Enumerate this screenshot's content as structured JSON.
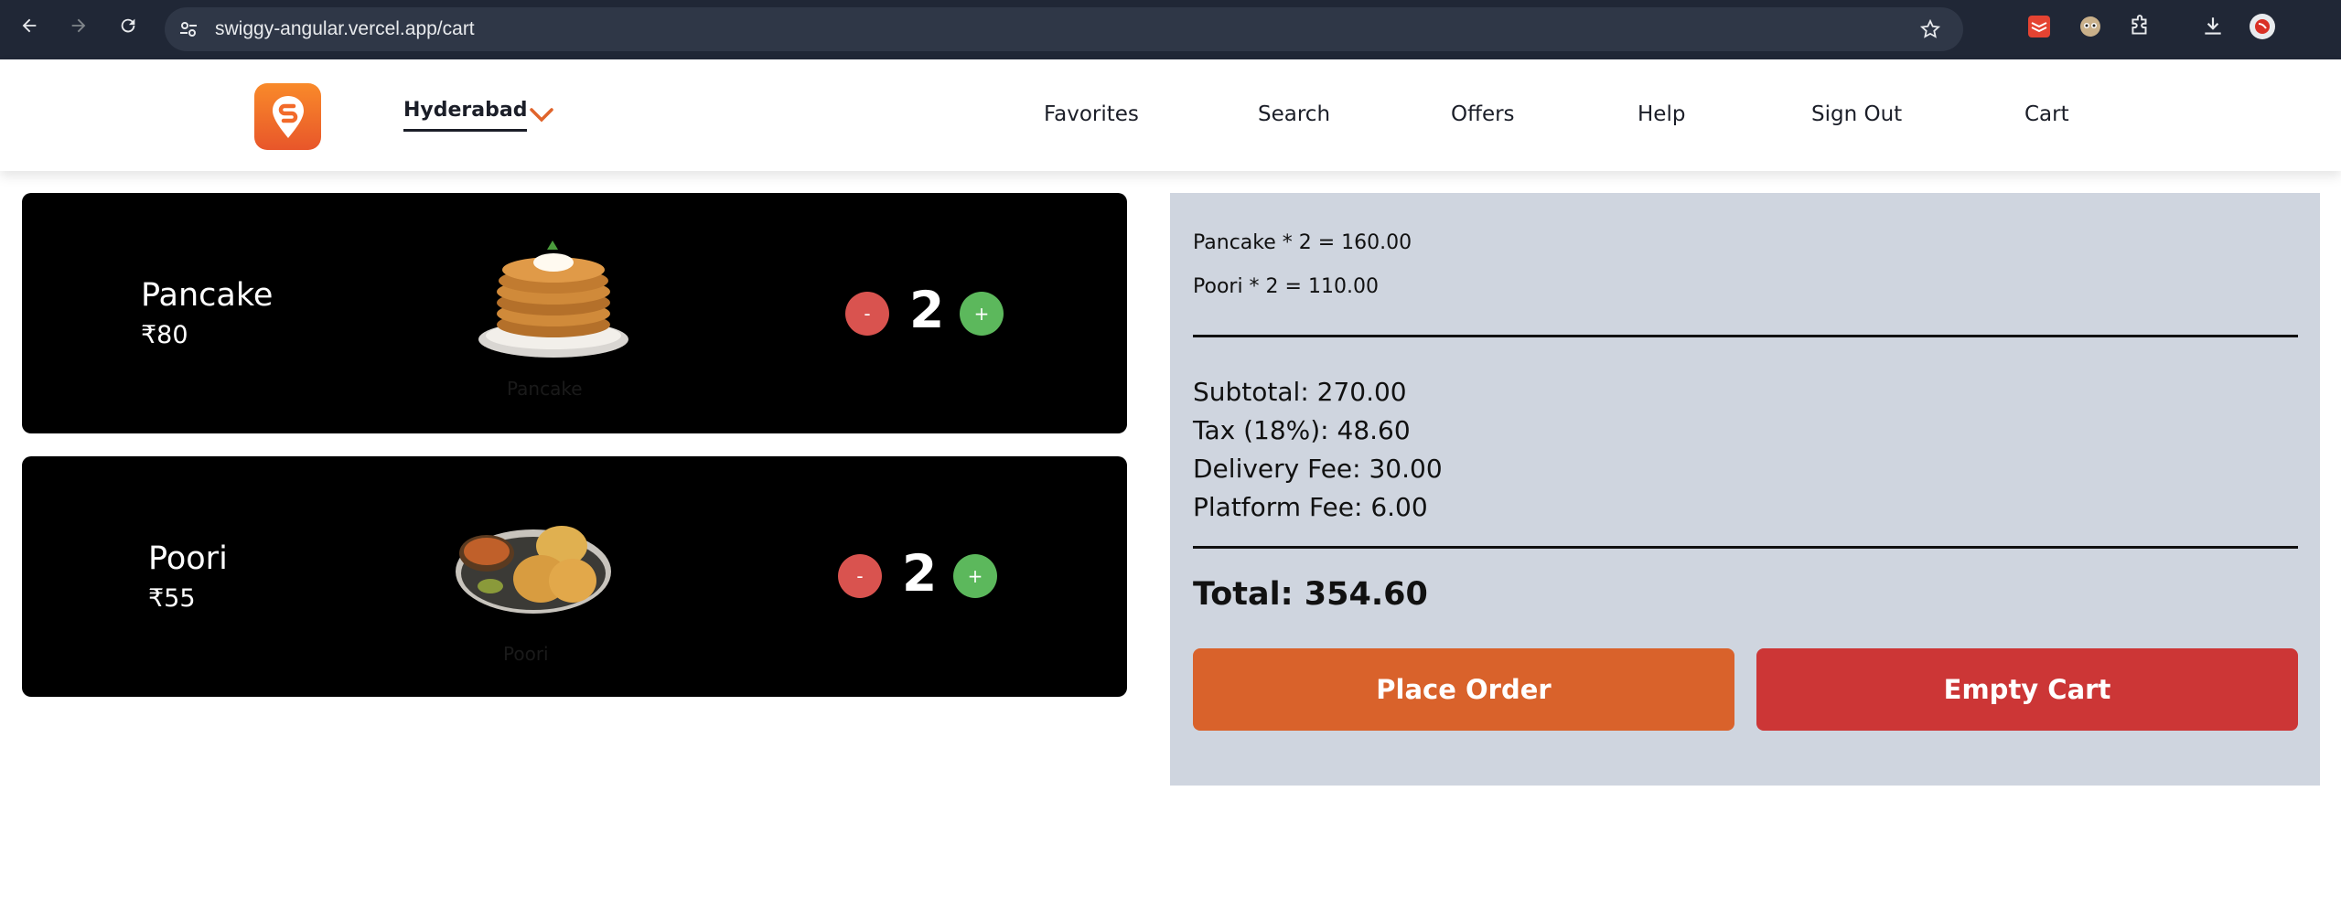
{
  "browser": {
    "url": "swiggy-angular.vercel.app/cart"
  },
  "header": {
    "brand_color": "#fc8019",
    "location": "Hyderabad",
    "nav": [
      "Favorites",
      "Search",
      "Offers",
      "Help",
      "Sign Out",
      "Cart"
    ]
  },
  "cart": {
    "items": [
      {
        "name": "Pancake",
        "price": "₹80",
        "image_caption": "Pancake",
        "quantity": "2",
        "minus_label": "-",
        "plus_label": "+"
      },
      {
        "name": "Poori",
        "price": "₹55",
        "image_caption": "Poori",
        "quantity": "2",
        "minus_label": "-",
        "plus_label": "+"
      }
    ]
  },
  "summary": {
    "lines": [
      "Pancake * 2 = 160.00",
      "Poori * 2 = 110.00"
    ],
    "subtotal": "Subtotal: 270.00",
    "tax": "Tax (18%): 48.60",
    "delivery": "Delivery Fee: 30.00",
    "platform": "Platform Fee: 6.00",
    "total": "Total: 354.60",
    "place_order": "Place Order",
    "empty_cart": "Empty Cart"
  }
}
